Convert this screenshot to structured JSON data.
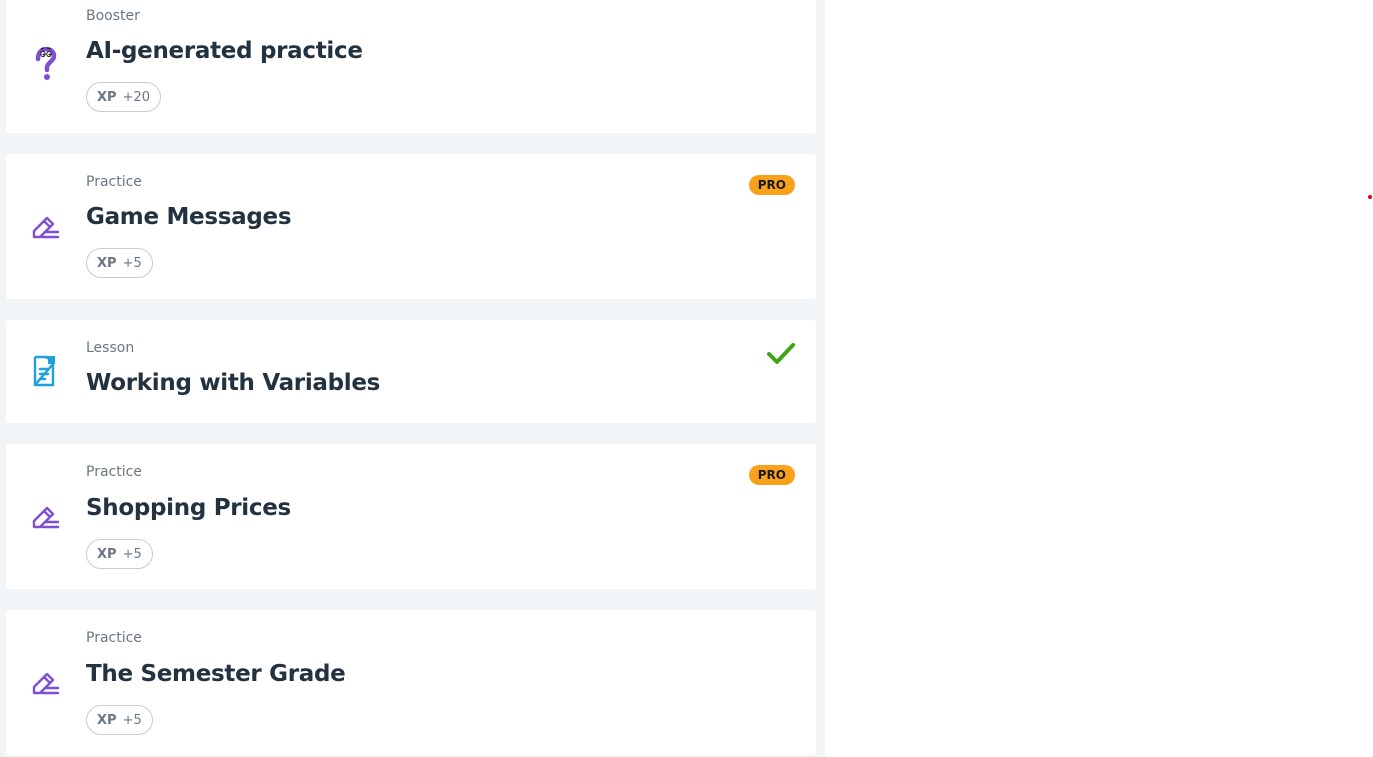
{
  "colors": {
    "accent_purple": "#7f4fd1",
    "lesson_blue": "#1fa0e0",
    "pro_orange": "#f9a11b",
    "check_green": "#3fa516",
    "panel_bg": "#f2f5f7"
  },
  "items": [
    {
      "type": "Booster",
      "title": "AI-generated practice",
      "xp_label": "XP",
      "xp_value": "+20",
      "icon": "question-mark-icon"
    },
    {
      "type": "Practice",
      "title": "Game Messages",
      "xp_label": "XP",
      "xp_value": "+5",
      "pro": "PRO",
      "icon": "pencil-icon"
    },
    {
      "type": "Lesson",
      "title": "Working with Variables",
      "completed": true,
      "icon": "document-icon"
    },
    {
      "type": "Practice",
      "title": "Shopping Prices",
      "xp_label": "XP",
      "xp_value": "+5",
      "pro": "PRO",
      "icon": "pencil-icon"
    },
    {
      "type": "Practice",
      "title": "The Semester Grade",
      "xp_label": "XP",
      "xp_value": "+5",
      "icon": "pencil-icon"
    }
  ]
}
